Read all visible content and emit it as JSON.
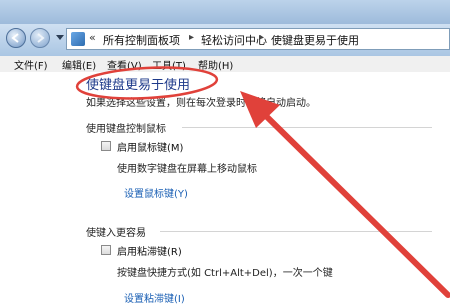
{
  "address_bar": {
    "breadcrumbs": [
      "所有控制面板项",
      "轻松访问中心",
      "使键盘更易于使用"
    ]
  },
  "menu": {
    "file": "文件(F)",
    "edit": "编辑(E)",
    "view": "查看(V)",
    "tools": "工具(T)",
    "help": "帮助(H)"
  },
  "page": {
    "title": "使键盘更易于使用",
    "description": "如果选择这些设置，则在每次登录时都将自动启动。"
  },
  "mouse_section": {
    "heading": "使用键盘控制鼠标",
    "checkbox_label": "启用鼠标键(M)",
    "checked": false,
    "help": "使用数字键盘在屏幕上移动鼠标",
    "link": "设置鼠标键(Y)"
  },
  "typing_section": {
    "heading": "使键入更容易",
    "checkbox_label": "启用粘滞键(R)",
    "checked": false,
    "help": "按键盘快捷方式(如 Ctrl+Alt+Del)，一次一个键",
    "link": "设置粘滞键(I)"
  },
  "colors": {
    "annotation": "#e0413a",
    "link": "#1a5fb4",
    "title": "#1e3a8a"
  }
}
